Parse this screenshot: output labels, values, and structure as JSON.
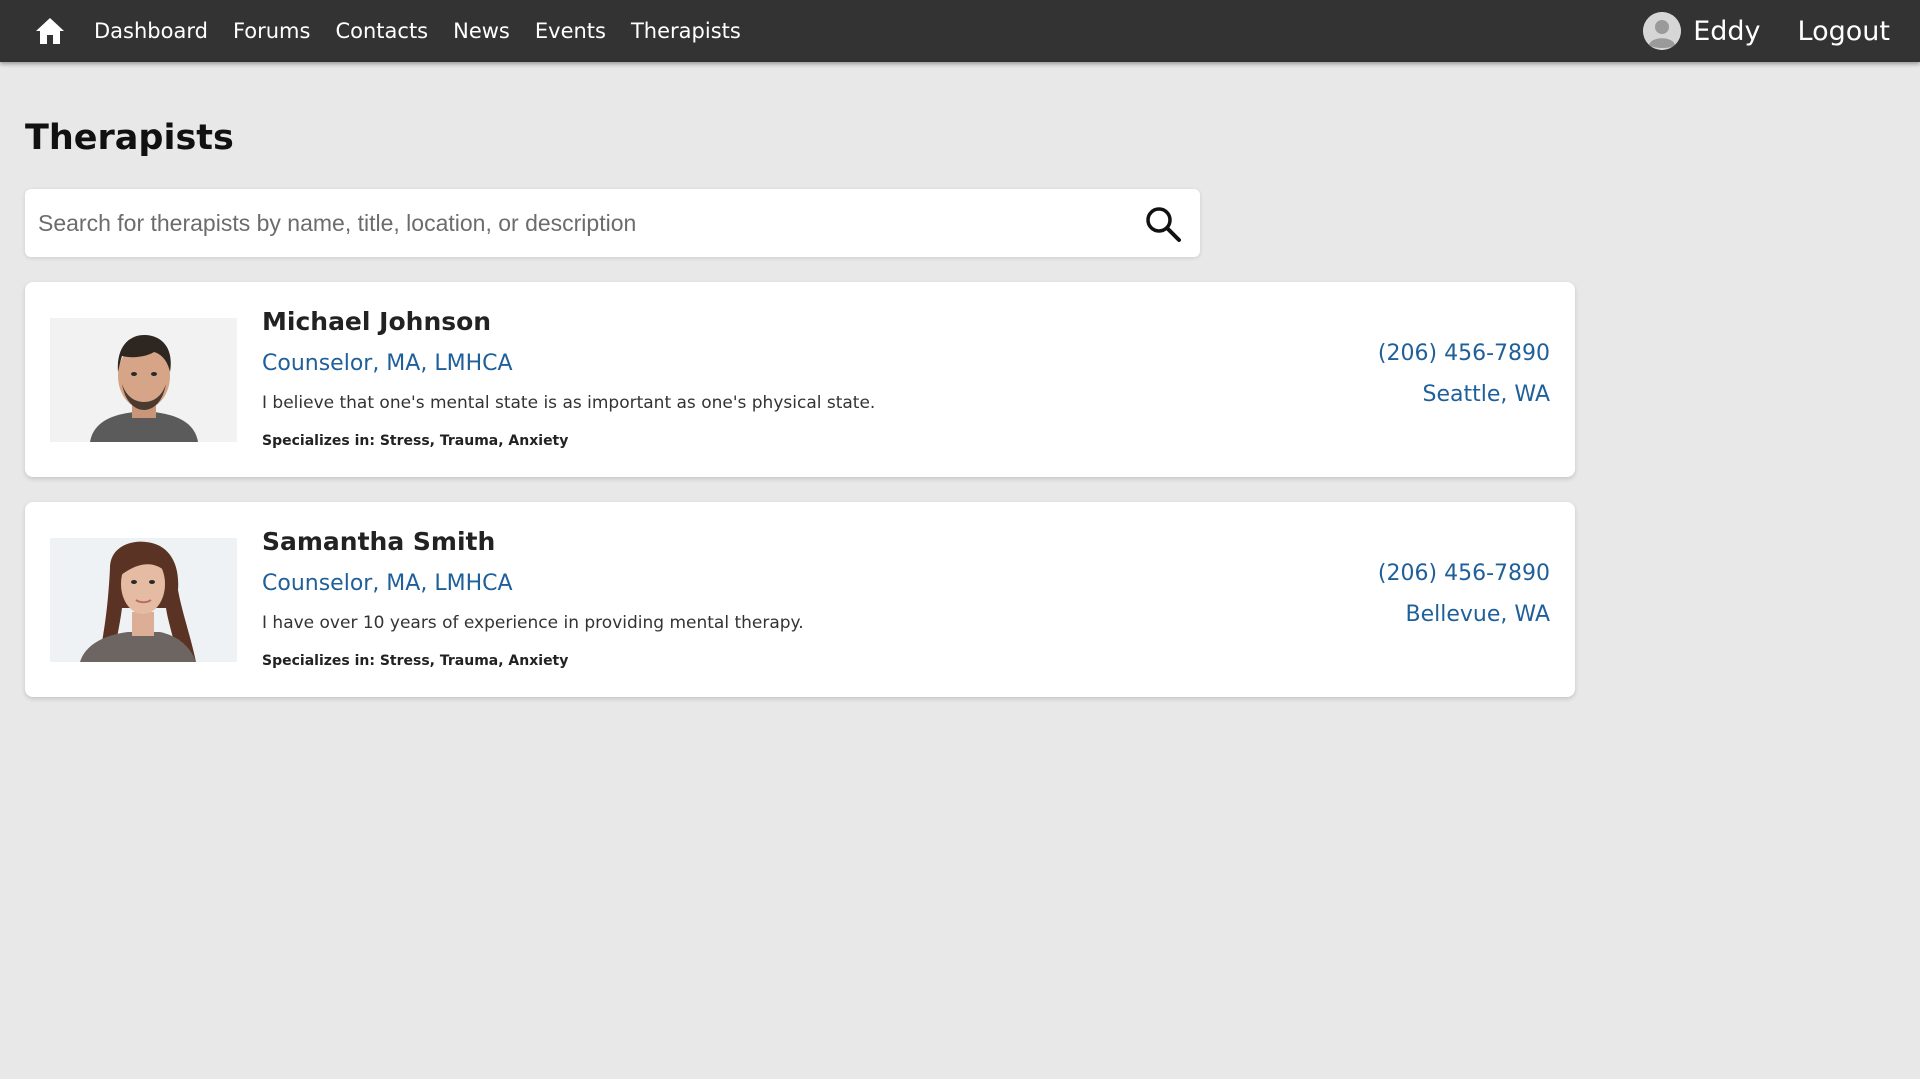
{
  "nav": {
    "links": [
      "Dashboard",
      "Forums",
      "Contacts",
      "News",
      "Events",
      "Therapists"
    ],
    "user_name": "Eddy",
    "logout_label": "Logout"
  },
  "page": {
    "title": "Therapists"
  },
  "search": {
    "placeholder": "Search for therapists by name, title, location, or description",
    "value": ""
  },
  "therapists": [
    {
      "name": "Michael Johnson",
      "title": "Counselor, MA, LMHCA",
      "description": "I believe that one's mental state is as important as one's physical state.",
      "specializes_label": "Specializes in:",
      "specialties": "Stress, Trauma, Anxiety",
      "phone": "(206) 456-7890",
      "location": "Seattle, WA"
    },
    {
      "name": "Samantha Smith",
      "title": "Counselor, MA, LMHCA",
      "description": "I have over 10 years of experience in providing mental therapy.",
      "specializes_label": "Specializes in:",
      "specialties": "Stress, Trauma, Anxiety",
      "phone": "(206) 456-7890",
      "location": "Bellevue, WA"
    }
  ],
  "colors": {
    "nav_background": "#333333",
    "page_background": "#e8e8e8",
    "link_blue": "#1f5f9a"
  }
}
